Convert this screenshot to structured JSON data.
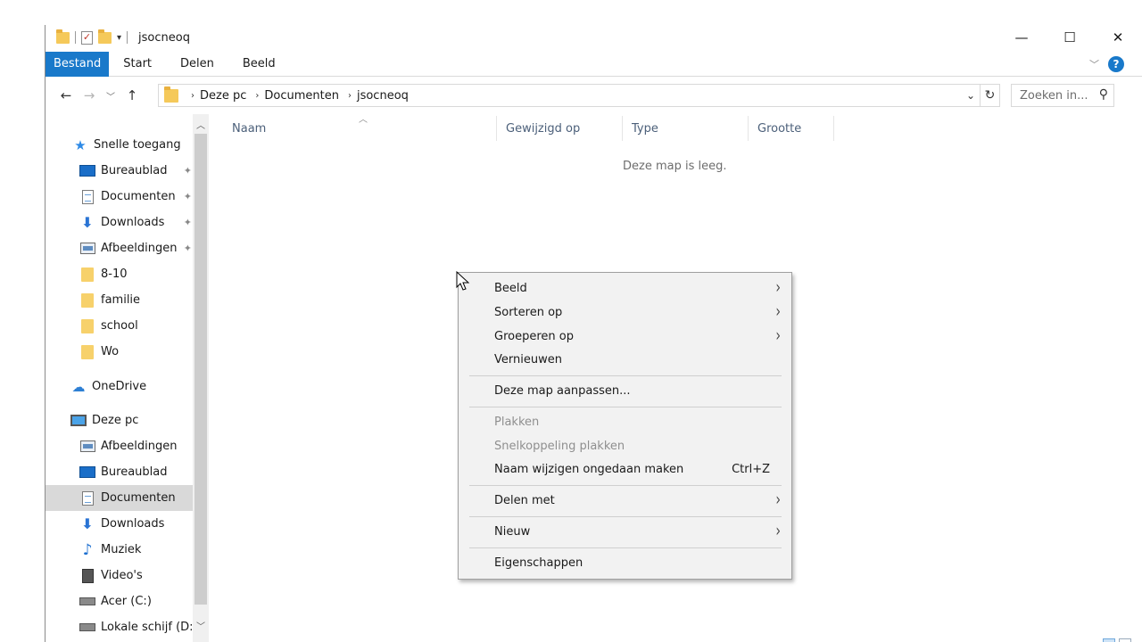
{
  "window": {
    "title": "jsocneoq",
    "controls": [
      "minimize-icon",
      "maximize-icon",
      "close-icon"
    ]
  },
  "quick_access_toolbar": {
    "icons": [
      "folder-icon",
      "properties-icon",
      "new-folder-icon",
      "customize-dropdown-icon"
    ]
  },
  "ribbon": {
    "tabs": [
      {
        "label": "Bestand",
        "active": true
      },
      {
        "label": "Start",
        "active": false
      },
      {
        "label": "Delen",
        "active": false
      },
      {
        "label": "Beeld",
        "active": false
      }
    ],
    "accent": "#1979ca"
  },
  "address_bar": {
    "crumbs": [
      "Deze pc",
      "Documenten",
      "jsocneoq"
    ],
    "search_placeholder": "Zoeken in..."
  },
  "sidebar": {
    "quick_access_label": "Snelle toegang",
    "quick_items": [
      {
        "label": "Bureaublad",
        "icon": "desktop-icon",
        "pinned": true
      },
      {
        "label": "Documenten",
        "icon": "document-icon",
        "pinned": true
      },
      {
        "label": "Downloads",
        "icon": "download-icon",
        "pinned": true
      },
      {
        "label": "Afbeeldingen",
        "icon": "pictures-icon",
        "pinned": true
      },
      {
        "label": "8-10",
        "icon": "folder-icon",
        "pinned": false
      },
      {
        "label": "familie",
        "icon": "folder-icon",
        "pinned": false
      },
      {
        "label": "school",
        "icon": "folder-icon",
        "pinned": false
      },
      {
        "label": "Wo",
        "icon": "folder-icon",
        "pinned": false
      }
    ],
    "onedrive_label": "OneDrive",
    "this_pc_label": "Deze pc",
    "pc_items": [
      {
        "label": "Afbeeldingen",
        "icon": "pictures-icon",
        "selected": false
      },
      {
        "label": "Bureaublad",
        "icon": "desktop-icon",
        "selected": false
      },
      {
        "label": "Documenten",
        "icon": "document-icon",
        "selected": true
      },
      {
        "label": "Downloads",
        "icon": "download-icon",
        "selected": false
      },
      {
        "label": "Muziek",
        "icon": "music-icon",
        "selected": false
      },
      {
        "label": "Video's",
        "icon": "video-icon",
        "selected": false
      },
      {
        "label": "Acer (C:)",
        "icon": "drive-icon",
        "selected": false
      },
      {
        "label": "Lokale schijf (D:)",
        "icon": "drive-icon",
        "selected": false
      }
    ]
  },
  "columns": [
    "Naam",
    "Gewijzigd op",
    "Type",
    "Grootte"
  ],
  "empty_message": "Deze map is leeg.",
  "context_menu": {
    "items": [
      {
        "label": "Beeld",
        "submenu": true
      },
      {
        "label": "Sorteren op",
        "submenu": true
      },
      {
        "label": "Groeperen op",
        "submenu": true
      },
      {
        "label": "Vernieuwen"
      },
      {
        "label": "Deze map aanpassen..."
      },
      {
        "label": "Plakken",
        "disabled": true
      },
      {
        "label": "Snelkoppeling plakken",
        "disabled": true
      },
      {
        "label": "Naam wijzigen ongedaan maken",
        "shortcut": "Ctrl+Z"
      },
      {
        "label": "Delen met",
        "submenu": true
      },
      {
        "label": "Nieuw",
        "submenu": true
      },
      {
        "label": "Eigenschappen"
      }
    ]
  }
}
